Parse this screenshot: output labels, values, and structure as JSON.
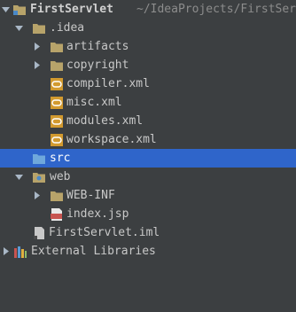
{
  "project": {
    "name": "FirstServlet",
    "path": "~/IdeaProjects/FirstServlet"
  },
  "tree": {
    "idea": ".idea",
    "artifacts": "artifacts",
    "copyright": "copyright",
    "compiler": "compiler.xml",
    "misc": "misc.xml",
    "modules": "modules.xml",
    "workspace": "workspace.xml",
    "src": "src",
    "web": "web",
    "webinf": "WEB-INF",
    "index": "index.jsp",
    "iml": "FirstServlet.iml",
    "external": "External Libraries"
  },
  "colors": {
    "background": "#3c3f41",
    "selection": "#2f65ca",
    "folder": "#b7a36a",
    "xml_file": "#d29a2f"
  }
}
